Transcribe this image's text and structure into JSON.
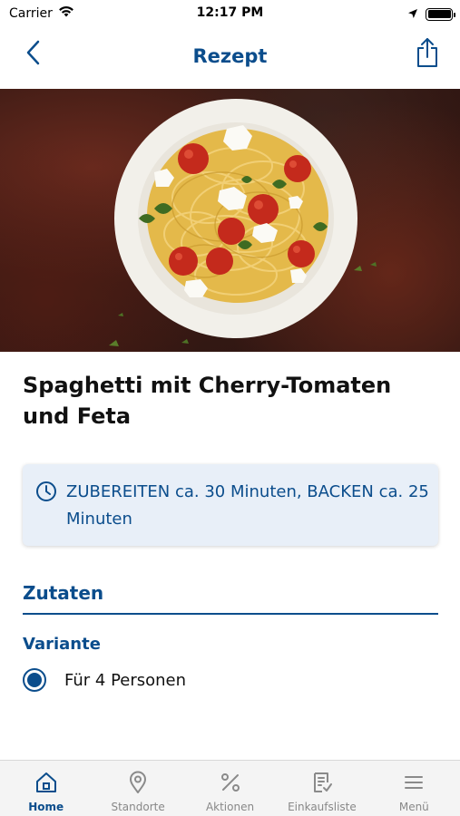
{
  "status_bar": {
    "carrier": "Carrier",
    "time": "12:17 PM"
  },
  "nav": {
    "title": "Rezept",
    "back_icon": "chevron-left-icon",
    "share_icon": "share-icon"
  },
  "recipe": {
    "title": "Spaghetti mit Cherry-Tomaten und Feta",
    "time_text": "ZUBEREITEN ca. 30 Minuten, BACKEN ca. 25 Minuten"
  },
  "ingredients": {
    "heading": "Zutaten",
    "variant_label": "Variante",
    "variants": [
      {
        "label": "Für 4 Personen",
        "selected": true
      }
    ]
  },
  "tab_bar": {
    "tabs": [
      {
        "label": "Home",
        "icon": "home-icon",
        "active": true
      },
      {
        "label": "Standorte",
        "icon": "location-pin-icon",
        "active": false
      },
      {
        "label": "Aktionen",
        "icon": "percent-icon",
        "active": false
      },
      {
        "label": "Einkaufsliste",
        "icon": "shopping-list-icon",
        "active": false
      },
      {
        "label": "Menü",
        "icon": "menu-icon",
        "active": false
      }
    ]
  },
  "colors": {
    "brand": "#0b4d8c",
    "card_background": "#e8eff8",
    "tab_inactive": "#888888"
  }
}
